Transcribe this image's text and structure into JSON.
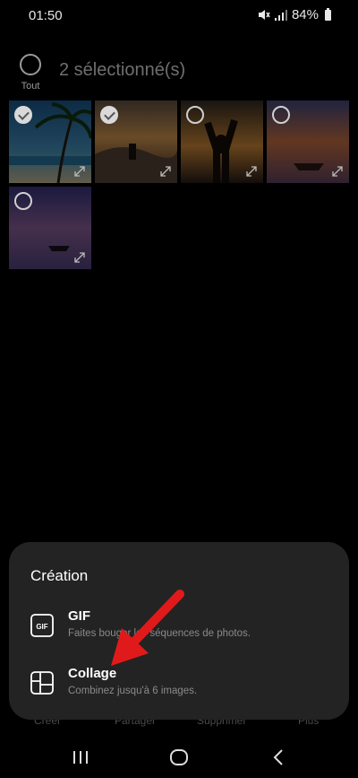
{
  "status": {
    "time": "01:50",
    "battery": "84%"
  },
  "header": {
    "select_all_label": "Tout",
    "selection_title": "2 sélectionné(s)"
  },
  "photos": [
    {
      "id": "p1",
      "selected": true
    },
    {
      "id": "p2",
      "selected": true
    },
    {
      "id": "p3",
      "selected": false
    },
    {
      "id": "p4",
      "selected": false
    },
    {
      "id": "p5",
      "selected": false
    }
  ],
  "bottom_actions": [
    "Créer",
    "Partager",
    "Supprimer",
    "Plus"
  ],
  "sheet": {
    "title": "Création",
    "options": [
      {
        "icon": "gif-icon",
        "icon_text": "GIF",
        "title": "GIF",
        "description": "Faites bouger les séquences de photos."
      },
      {
        "icon": "collage-icon",
        "title": "Collage",
        "description": "Combinez jusqu'à 6 images."
      }
    ]
  },
  "colors": {
    "background": "#000000",
    "sheet": "#232323",
    "arrow": "#e01a1a"
  }
}
